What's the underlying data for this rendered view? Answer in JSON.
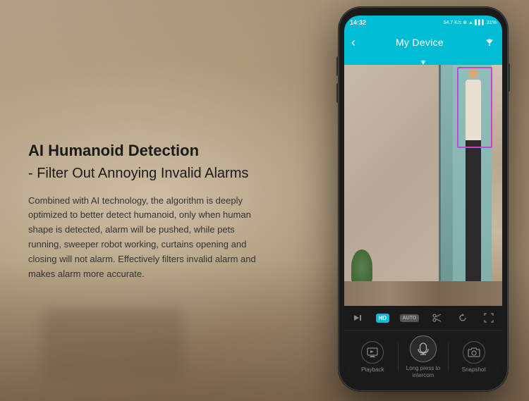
{
  "background": {
    "description": "Blurred living room background"
  },
  "left_content": {
    "headline": "AI Humanoid Detection",
    "subheadline": "- Filter Out Annoying Invalid Alarms",
    "description": "Combined with AI technology, the algorithm is deeply optimized to better detect humanoid, only when human shape is detected, alarm will be pushed, while pets running, sweeper robot working, curtains opening and closing will not alarm. Effectively filters invalid alarm and makes alarm more accurate."
  },
  "phone": {
    "status_bar": {
      "time": "14:32",
      "info": "54.7 K/s",
      "battery": "31%",
      "signal": "▲▼"
    },
    "header": {
      "title": "My Device",
      "back_icon": "‹",
      "wifi_icon": "wifi"
    },
    "controls": {
      "hd_label": "HD",
      "auto_label": "AUTO"
    },
    "actions": {
      "items": [
        {
          "label": "Playback",
          "icon": "playback"
        },
        {
          "label": "Long press to intercom",
          "icon": "microphone"
        },
        {
          "label": "Snapshot",
          "icon": "camera"
        }
      ]
    },
    "detection_box": {
      "color": "#cc44cc",
      "description": "Person detection bounding box"
    }
  },
  "colors": {
    "primary": "#00bcd4",
    "background": "#c8b89a",
    "text_dark": "#1a1a1a",
    "text_body": "#333333",
    "phone_bg": "#1a1a1a",
    "detection": "#cc44cc"
  }
}
